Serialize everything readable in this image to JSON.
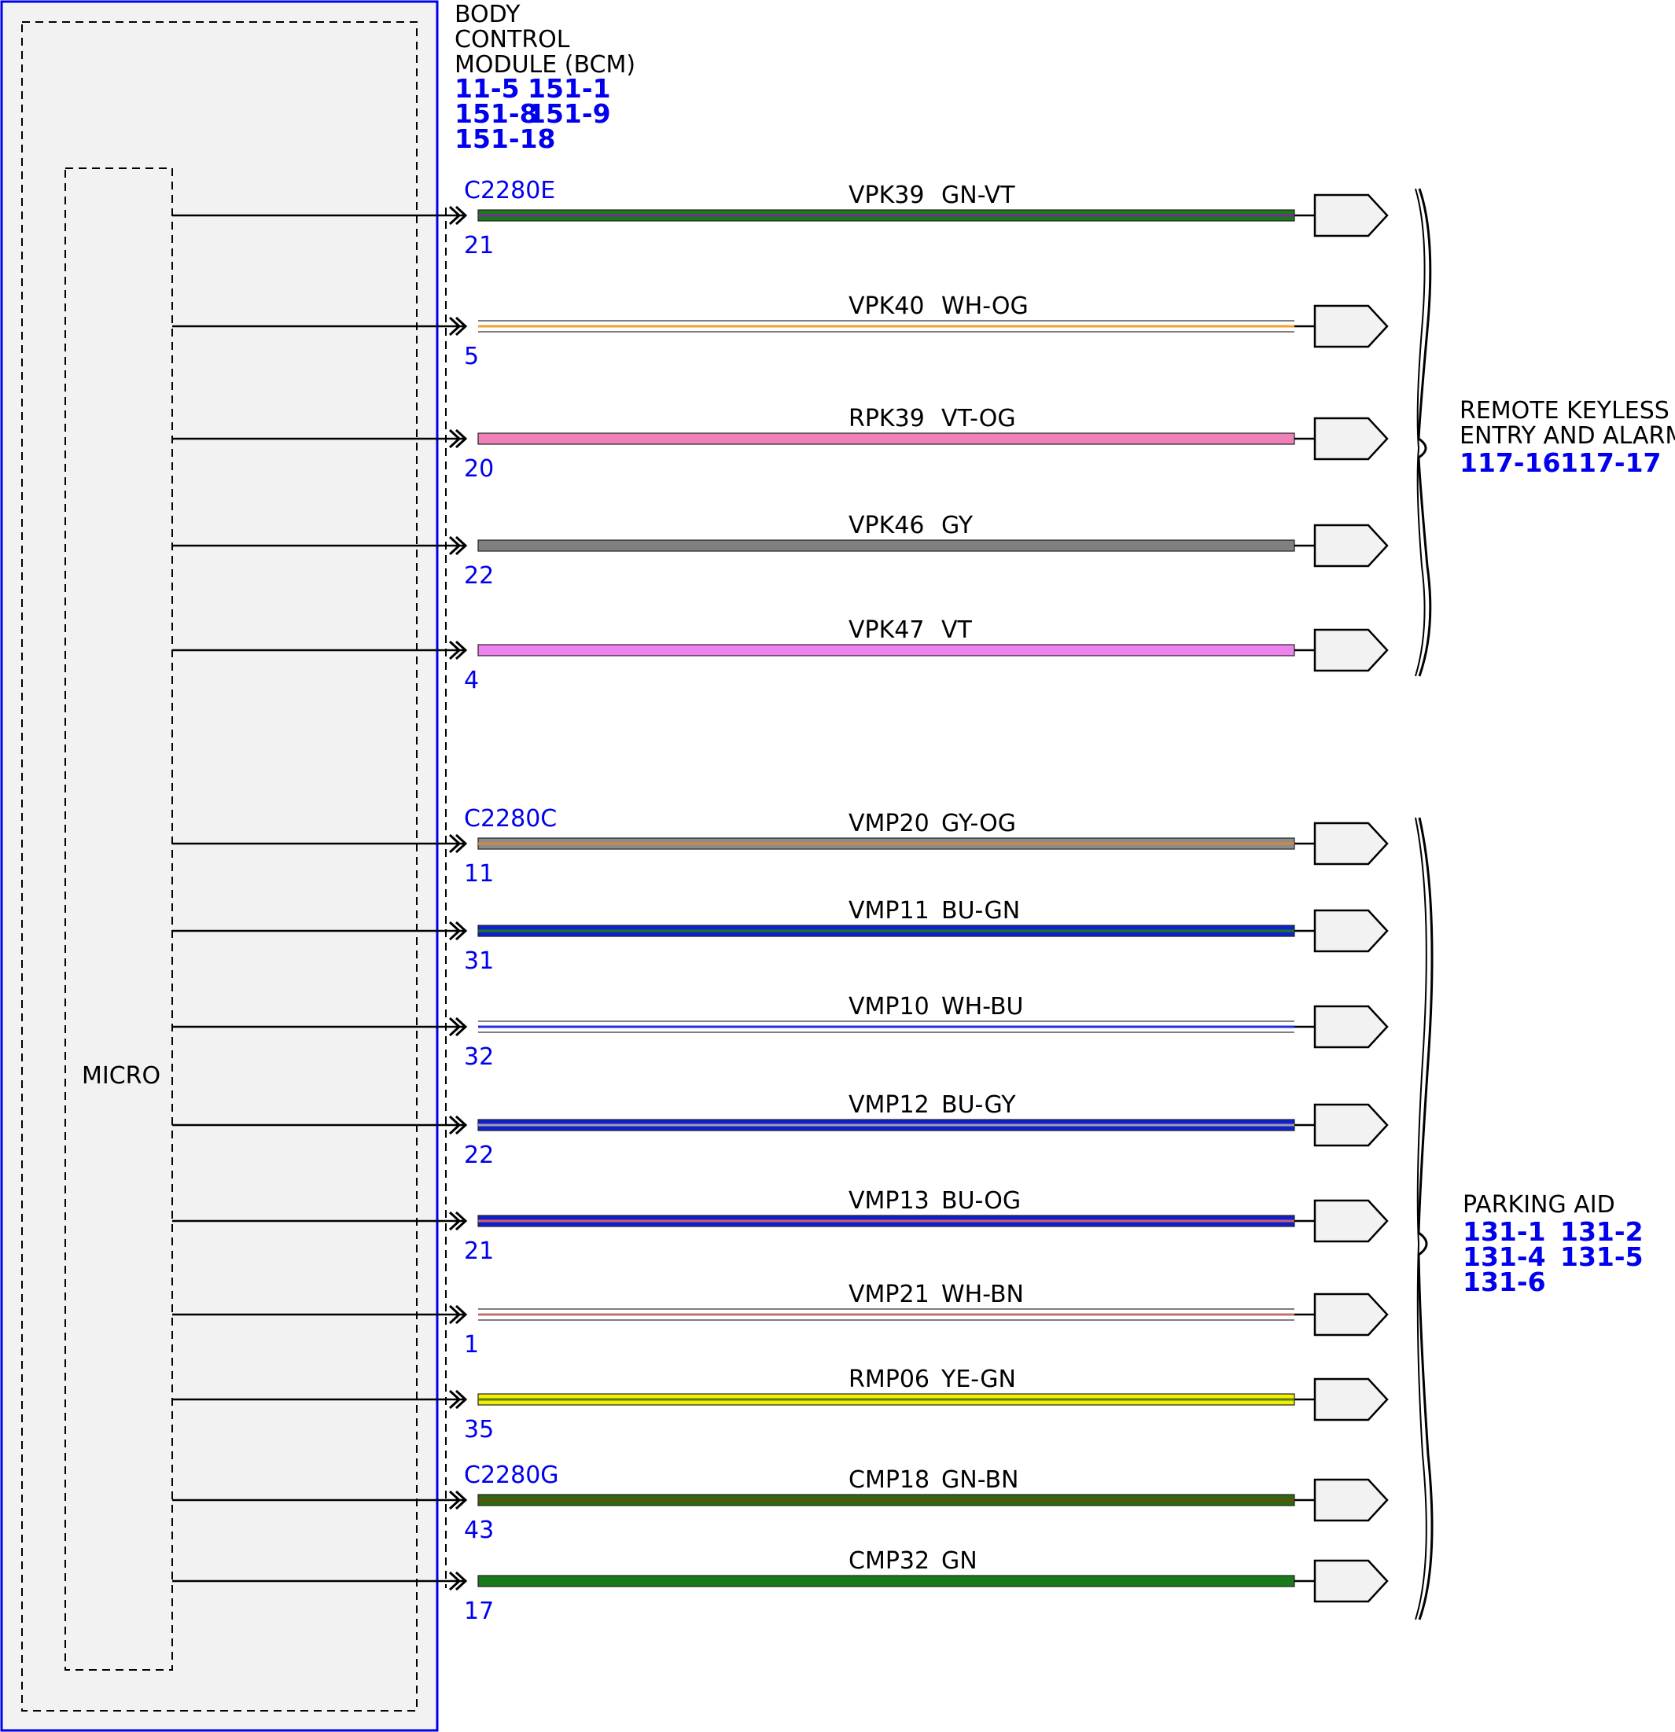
{
  "module": {
    "title_lines": [
      "BODY",
      "CONTROL",
      "MODULE (BCM)"
    ],
    "ref_lines": [
      [
        "11-5",
        "151-1"
      ],
      [
        "151-8",
        "151-9"
      ],
      [
        "151-18"
      ]
    ],
    "micro_label": "MICRO",
    "colors": {
      "border": "#0000ee",
      "fill": "#f2f2f2"
    }
  },
  "connectors": [
    {
      "id": "C2280E"
    },
    {
      "id": "C2280C"
    },
    {
      "id": "C2280G"
    }
  ],
  "wires": [
    {
      "circuit": "VPK39",
      "color_code": "GN-VT",
      "pin": "21",
      "connector": "C2280E",
      "base": "#1a7a1a",
      "stripe": "#7a2a9a",
      "style": "solid"
    },
    {
      "circuit": "VPK40",
      "color_code": "WH-OG",
      "pin": "5",
      "base": "#ffffff",
      "stripe": "#f0a030",
      "style": "light"
    },
    {
      "circuit": "RPK39",
      "color_code": "VT-OG",
      "pin": "20",
      "base": "#f080b8",
      "stripe": "#f080b8",
      "style": "solid"
    },
    {
      "circuit": "VPK46",
      "color_code": "GY",
      "pin": "22",
      "base": "#808080",
      "stripe": "#808080",
      "style": "solid"
    },
    {
      "circuit": "VPK47",
      "color_code": "VT",
      "pin": "4",
      "base": "#ee82ee",
      "stripe": "#ee82ee",
      "style": "solid"
    },
    {
      "circuit": "VMP20",
      "color_code": "GY-OG",
      "pin": "11",
      "connector": "C2280C",
      "base": "#8c8c8c",
      "stripe": "#d08a3a",
      "style": "solid"
    },
    {
      "circuit": "VMP11",
      "color_code": "BU-GN",
      "pin": "31",
      "base": "#1020d0",
      "stripe": "#1a7a1a",
      "style": "solid"
    },
    {
      "circuit": "VMP10",
      "color_code": "WH-BU",
      "pin": "32",
      "base": "#ffffff",
      "stripe": "#2030e0",
      "style": "light"
    },
    {
      "circuit": "VMP12",
      "color_code": "BU-GY",
      "pin": "22",
      "base": "#1020d0",
      "stripe": "#a0a0a0",
      "style": "solid"
    },
    {
      "circuit": "VMP13",
      "color_code": "BU-OG",
      "pin": "21",
      "base": "#1020d0",
      "stripe": "#d06060",
      "style": "solid"
    },
    {
      "circuit": "VMP21",
      "color_code": "WH-BN",
      "pin": "1",
      "base": "#ffffff",
      "stripe": "#c07070",
      "style": "light"
    },
    {
      "circuit": "RMP06",
      "color_code": "YE-GN",
      "pin": "35",
      "base": "#f0f000",
      "stripe": "#5a7a10",
      "style": "solid"
    },
    {
      "circuit": "CMP18",
      "color_code": "GN-BN",
      "pin": "43",
      "connector": "C2280G",
      "base": "#2a6a10",
      "stripe": "#6a4a10",
      "style": "solid"
    },
    {
      "circuit": "CMP32",
      "color_code": "GN",
      "pin": "17",
      "base": "#1a7a1a",
      "stripe": "#1a7a1a",
      "style": "solid"
    }
  ],
  "destinations": [
    {
      "lines": [
        "REMOTE KEYLESS",
        "ENTRY AND ALARM"
      ],
      "refs": [
        [
          "117-16",
          "117-17"
        ]
      ]
    },
    {
      "lines": [
        "PARKING AID"
      ],
      "refs": [
        [
          "131-1",
          "131-2"
        ],
        [
          "131-4",
          "131-5"
        ],
        [
          "131-6"
        ]
      ]
    }
  ]
}
